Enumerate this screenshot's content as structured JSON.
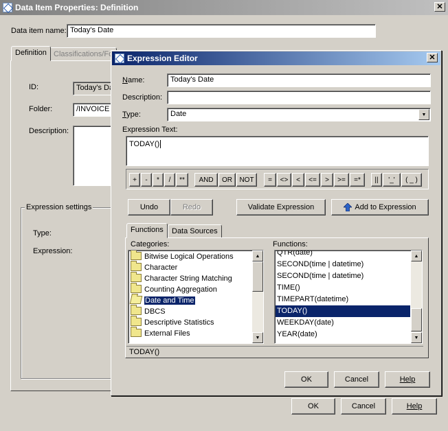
{
  "outer_dialog": {
    "title": "Data Item Properties: Definition",
    "data_item_name_label": "Data item name:",
    "data_item_name_value": "Today's Date",
    "tabs": [
      {
        "label": "Definition"
      },
      {
        "label": "Classifications/Fo"
      }
    ],
    "id_label": "ID:",
    "id_value": "Today's Da",
    "folder_label": "Folder:",
    "folder_value": "/INVOICE",
    "description_label": "Description:",
    "expression_settings_title": "Expression settings",
    "type_label": "Type:",
    "expression_label": "Expression:",
    "ok_label": "OK",
    "cancel_label": "Cancel",
    "help_label": "Help"
  },
  "editor": {
    "title": "Expression Editor",
    "name_label": "Name:",
    "name_value": "Today's Date",
    "description_label": "Description:",
    "description_value": "",
    "type_label": "Type:",
    "type_value": "Date",
    "expression_text_label": "Expression Text:",
    "expression_value": "TODAY()",
    "operators_group1": [
      "+",
      "-",
      "*",
      "/",
      "**"
    ],
    "operators_group2": [
      "AND",
      "OR",
      "NOT"
    ],
    "operators_group3": [
      "=",
      "<>",
      "<",
      "<=",
      ">",
      ">=",
      "=*"
    ],
    "operators_group4": [
      "||",
      "'_'",
      "( _ )"
    ],
    "undo_label": "Undo",
    "redo_label": "Redo",
    "validate_label": "Validate Expression",
    "add_label": "Add to Expression",
    "tabs": [
      {
        "label": "Functions"
      },
      {
        "label": "Data Sources"
      }
    ],
    "categories_label": "Categories:",
    "functions_label": "Functions:",
    "categories": [
      {
        "label": "Bitwise Logical Operations"
      },
      {
        "label": "Character"
      },
      {
        "label": "Character String Matching"
      },
      {
        "label": "Counting Aggregation"
      },
      {
        "label": "Date and Time"
      },
      {
        "label": "DBCS"
      },
      {
        "label": "Descriptive Statistics"
      },
      {
        "label": "External Files"
      }
    ],
    "functions": [
      {
        "label": "QTR(date)"
      },
      {
        "label": "SECOND(time | datetime)"
      },
      {
        "label": "SECOND(time | datetime)"
      },
      {
        "label": "TIME()"
      },
      {
        "label": "TIMEPART(datetime)"
      },
      {
        "label": "TODAY()"
      },
      {
        "label": "WEEKDAY(date)"
      },
      {
        "label": "YEAR(date)"
      }
    ],
    "status_text": "TODAY()",
    "ok_label": "OK",
    "cancel_label": "Cancel",
    "help_label": "Help"
  },
  "colors": {
    "active_title": "#0a246a",
    "inactive_title": "#808080",
    "selection": "#0a246a",
    "face": "#d4d0c8"
  }
}
